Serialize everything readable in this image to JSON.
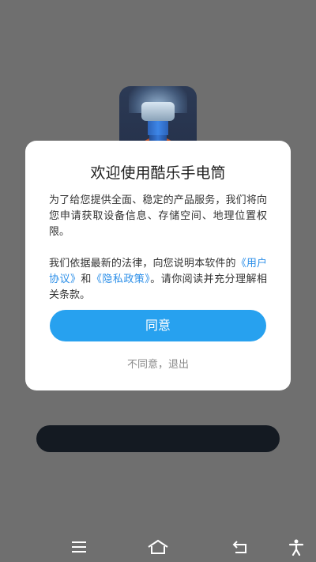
{
  "dialog": {
    "title": "欢迎使用酷乐手电筒",
    "para1": "为了给您提供全面、稳定的产品服务，我们将向您申请获取设备信息、存储空间、地理位置权限。",
    "para2_prefix": "我们依据最新的法律，向您说明本软件的",
    "user_agreement_link": "《用户协议》",
    "and_text": "和",
    "privacy_policy_link": "《隐私政策》",
    "para2_suffix": "。请你阅读并充分理解相关条款。",
    "agree_label": "同意",
    "disagree_label": "不同意，退出"
  },
  "colors": {
    "accent": "#27a1ef",
    "link": "#2a8ee8",
    "overlay": "#6f6f6f"
  },
  "navbar": {
    "icons": [
      "menu-icon",
      "home-icon",
      "back-icon",
      "accessibility-icon"
    ]
  }
}
